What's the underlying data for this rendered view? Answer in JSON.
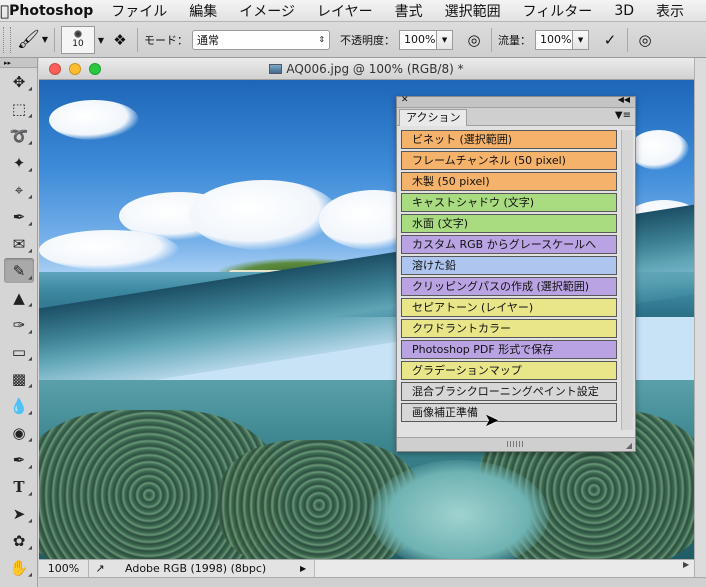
{
  "menubar": {
    "app_name": "Photoshop",
    "items": [
      "ファイル",
      "編集",
      "イメージ",
      "レイヤー",
      "書式",
      "選択範囲",
      "フィルター",
      "3D",
      "表示"
    ]
  },
  "options_bar": {
    "brush_size": "10",
    "mode_label": "モード：",
    "mode_value": "通常",
    "opacity_label": "不透明度：",
    "opacity_value": "100%",
    "flow_label": "流量：",
    "flow_value": "100%"
  },
  "document": {
    "title": "AQ006.jpg @ 100% (RGB/8) *",
    "zoom": "100%",
    "color_profile": "Adobe RGB (1998) (8bpc)"
  },
  "actions_panel": {
    "tab_label": "アクション",
    "items": [
      {
        "label": "ビネット (選択範囲)",
        "color": "#f5b26b"
      },
      {
        "label": "フレームチャンネル (50 pixel)",
        "color": "#f5b26b"
      },
      {
        "label": "木製 (50 pixel)",
        "color": "#f5b26b"
      },
      {
        "label": "キャストシャドウ (文字)",
        "color": "#a9dc80"
      },
      {
        "label": "水面 (文字)",
        "color": "#a9dc80"
      },
      {
        "label": "カスタム RGB からグレースケールへ",
        "color": "#b9a3e3"
      },
      {
        "label": "溶けた鉛",
        "color": "#aec6ef"
      },
      {
        "label": "クリッピングパスの作成 (選択範囲)",
        "color": "#b9a3e3"
      },
      {
        "label": "セピアトーン (レイヤー)",
        "color": "#e9e68a"
      },
      {
        "label": "クワドラントカラー",
        "color": "#e9e68a"
      },
      {
        "label": "Photoshop PDF 形式で保存",
        "color": "#b9a3e3"
      },
      {
        "label": "グラデーションマップ",
        "color": "#e9e68a"
      },
      {
        "label": "混合ブラシクローニングペイント設定",
        "color": "#d7d7d7"
      },
      {
        "label": "画像補正準備",
        "color": "#d7d7d7"
      }
    ]
  },
  "tools": [
    "move-tool",
    "marquee-tool",
    "lasso-tool",
    "magic-wand-tool",
    "crop-tool",
    "eyedropper-tool",
    "healing-brush-tool",
    "brush-tool",
    "clone-stamp-tool",
    "history-brush-tool",
    "eraser-tool",
    "gradient-tool",
    "blur-tool",
    "dodge-tool",
    "pen-tool",
    "type-tool",
    "path-selection-tool",
    "shape-tool",
    "hand-tool"
  ]
}
